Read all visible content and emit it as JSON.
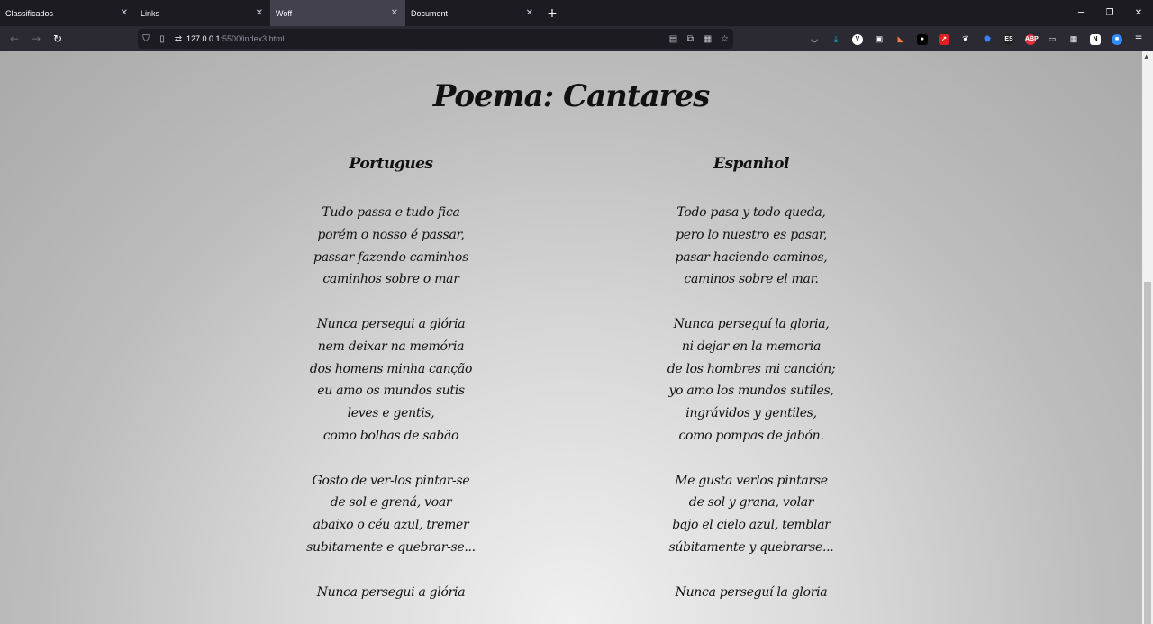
{
  "tabs": [
    {
      "label": "Classificados",
      "active": false
    },
    {
      "label": "Links",
      "active": false
    },
    {
      "label": "Woff",
      "active": true
    },
    {
      "label": "Document",
      "active": false
    }
  ],
  "url": {
    "host": "127.0.0.1",
    "path": ":5500/index3.html"
  },
  "window_controls": [
    "minimize-icon",
    "restore-icon",
    "close-icon"
  ],
  "extensions": [
    "pocket-icon",
    "download-icon",
    "v-extension-icon",
    "id-extension-icon",
    "shield-extension-icon",
    "lock-extension-icon",
    "red-extension-icon",
    "bird-extension-icon",
    "blue-extension-icon",
    "es-extension-icon",
    "abp-icon",
    "sidebar-icon",
    "grid-icon",
    "notion-icon",
    "zoom-icon",
    "menu-icon"
  ],
  "page": {
    "title": "Poema: Cantares",
    "columns": [
      {
        "heading": "Portugues",
        "stanzas": [
          [
            "Tudo passa e tudo fica",
            "porém o nosso é passar,",
            "passar fazendo caminhos",
            "caminhos sobre o mar"
          ],
          [
            "Nunca persegui a glória",
            "nem deixar na memória",
            "dos homens minha canção",
            "eu amo os mundos sutis",
            "leves e gentis,",
            "como bolhas de sabão"
          ],
          [
            "Gosto de ver-los pintar-se",
            "de sol e grená, voar",
            "abaixo o céu azul, tremer",
            "subitamente e quebrar-se..."
          ],
          [
            "Nunca persegui a glória"
          ]
        ]
      },
      {
        "heading": "Espanhol",
        "stanzas": [
          [
            "Todo pasa y todo queda,",
            "pero lo nuestro es pasar,",
            "pasar haciendo caminos,",
            "caminos sobre el mar."
          ],
          [
            "Nunca perseguí la gloria,",
            "ni dejar en la memoria",
            "de los hombres mi canción;",
            "yo amo los mundos sutiles,",
            "ingrávidos y gentiles,",
            "como pompas de jabón."
          ],
          [
            "Me gusta verlos pintarse",
            "de sol y grana, volar",
            "bajo el cielo azul, temblar",
            "súbitamente y quebrarse..."
          ],
          [
            "Nunca perseguí la gloria"
          ]
        ]
      }
    ]
  }
}
